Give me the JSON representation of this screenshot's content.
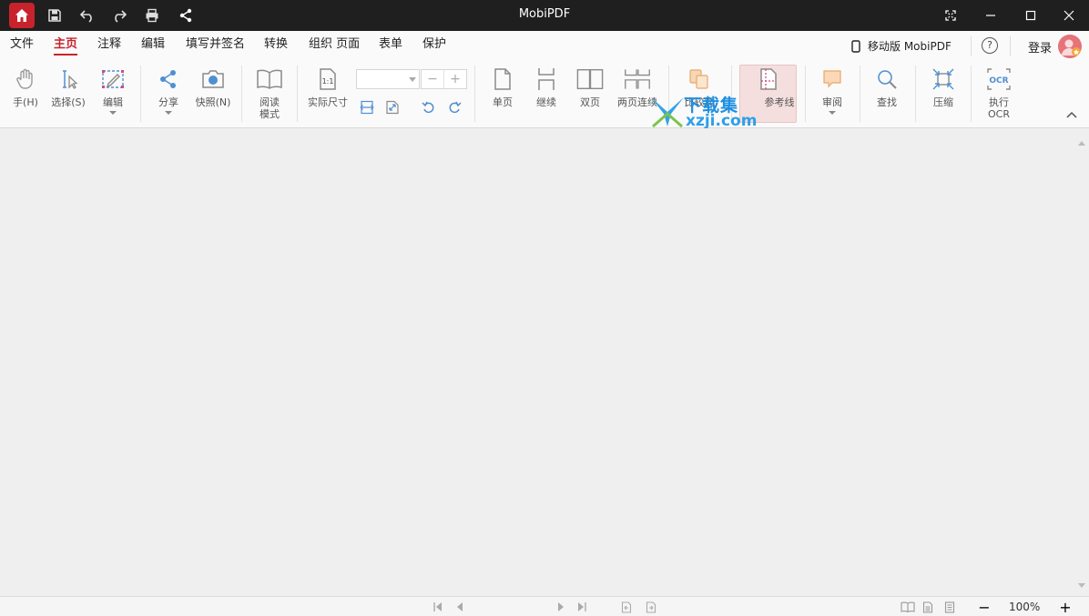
{
  "app": {
    "title": "MobiPDF"
  },
  "menu": {
    "items": [
      {
        "label": "文件",
        "active": false
      },
      {
        "label": "主页",
        "active": true
      },
      {
        "label": "注释",
        "active": false
      },
      {
        "label": "编辑",
        "active": false
      },
      {
        "label": "填写并签名",
        "active": false
      },
      {
        "label": "转换",
        "active": false
      },
      {
        "label": "组织 页面",
        "active": false
      },
      {
        "label": "表单",
        "active": false
      },
      {
        "label": "保护",
        "active": false
      }
    ],
    "mobile_label": "移动版 MobiPDF",
    "help_label": "?",
    "login_label": "登录"
  },
  "toolbar": {
    "hand": "手(H)",
    "select": "选择(S)",
    "edit": "编辑",
    "share": "分享",
    "snapshot": "快照(N)",
    "reading_mode_1": "阅读",
    "reading_mode_2": "模式",
    "actual_size": "实际尺寸",
    "zoom_value": "",
    "zoom_minus": "−",
    "zoom_plus": "+",
    "single_page": "单页",
    "continuous": "继续",
    "two_page": "双页",
    "two_page_continuous": "两页连续",
    "compare": "比较文",
    "guides": "参考线",
    "review": "审阅",
    "find": "查找",
    "compress": "压缩",
    "ocr_1": "执行",
    "ocr_2": "OCR",
    "ocr_icon_text": "OCR",
    "actual_size_icon_text": "1:1"
  },
  "statusbar": {
    "zoom": "100%",
    "zoom_minus": "−",
    "zoom_plus": "+"
  },
  "watermark": {
    "line1": "下载集",
    "line2": "xzji.com"
  },
  "colors": {
    "accent": "#c8232c",
    "titlebar": "#1f1f1f",
    "icon_blue": "#4f8fd1",
    "icon_gray": "#8a8a8a"
  }
}
